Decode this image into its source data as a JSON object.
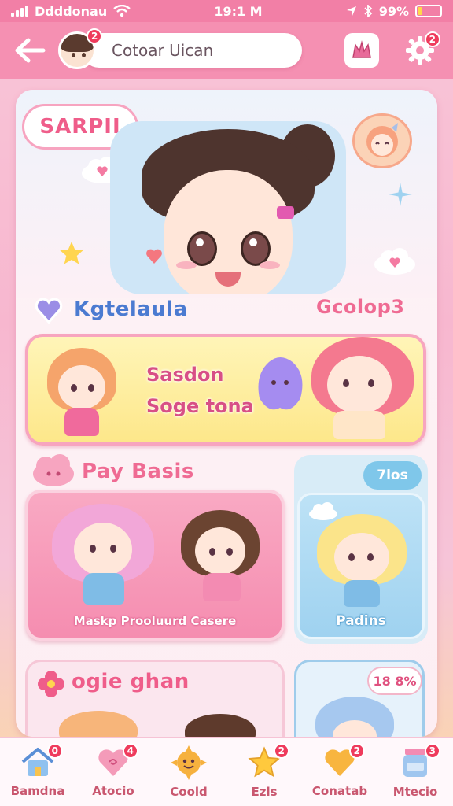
{
  "status_bar": {
    "carrier": "Ddddonau",
    "time": "19:1 M",
    "battery": "99%",
    "battery_level": 0.2
  },
  "header": {
    "back_label": "←",
    "avatar_badge": "2",
    "search_placeholder": "Cotoar Uican",
    "search_value": "Cotoar Uican"
  },
  "hero": {
    "bubble_text": "SARPII"
  },
  "section_one": {
    "title": "Kgtelaula",
    "right_title": "Gcolop3",
    "banner_line1": "Sasdon",
    "banner_line2": "Soge tona"
  },
  "section_two": {
    "title": "Pay Basis",
    "pill": "7los",
    "card_caption": "Maskp Prooluurd Casere",
    "side_caption": "Padins"
  },
  "section_three": {
    "title": "ogie ghan",
    "pill": "18 8%"
  },
  "nav": [
    {
      "label": "Bamdna",
      "icon": "home-icon",
      "badge": "0"
    },
    {
      "label": "Atocio",
      "icon": "heart-swirl-icon",
      "badge": "4"
    },
    {
      "label": "Coold",
      "icon": "sun-face-icon",
      "badge": ""
    },
    {
      "label": "Ezls",
      "icon": "star-icon",
      "badge": "2"
    },
    {
      "label": "Conatab",
      "icon": "heart-icon",
      "badge": "2"
    },
    {
      "label": "Mtecio",
      "icon": "jar-icon",
      "badge": "3"
    }
  ],
  "colors": {
    "accent": "#f27fa6",
    "header": "#f590b2",
    "badge": "#ef3b5c",
    "banner": "#fde78a",
    "side": "#9fd2f0"
  }
}
